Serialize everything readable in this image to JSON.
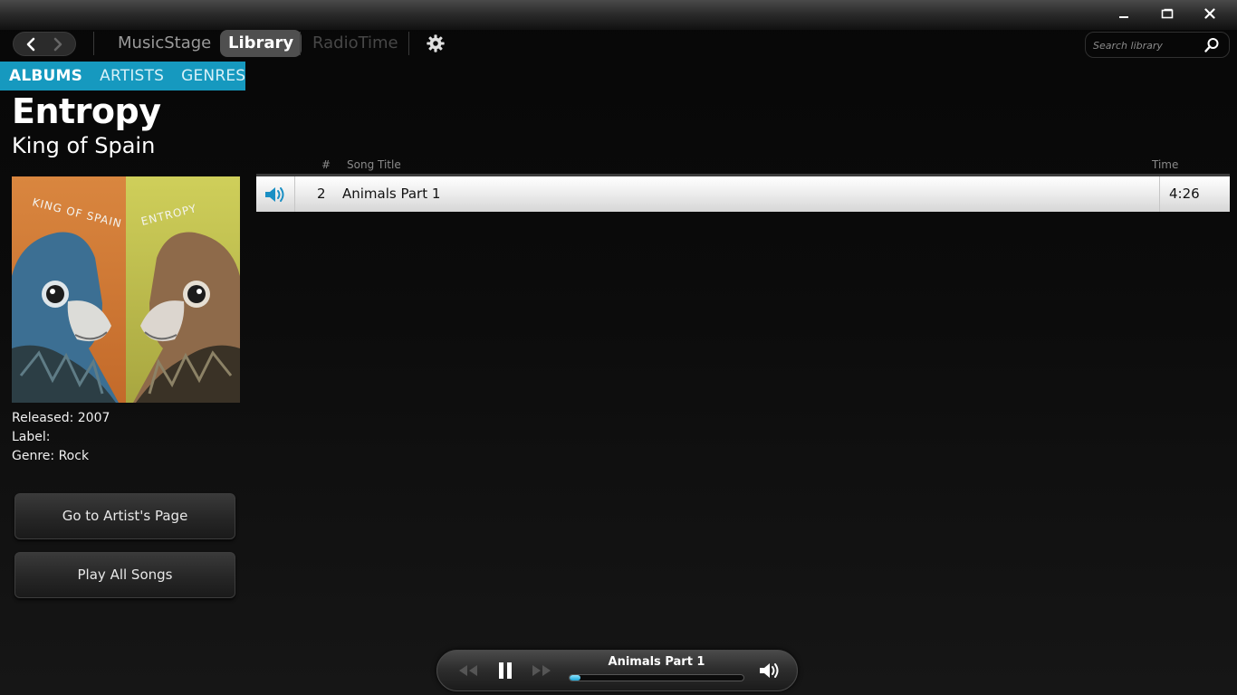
{
  "window": {
    "minimize_label": "",
    "maximize_label": "",
    "close_label": ""
  },
  "nav": {
    "links": [
      "MusicStage",
      "Library",
      "RadioTime"
    ],
    "active": "Library",
    "search_placeholder": "Search library"
  },
  "subtabs": [
    "ALBUMS",
    "ARTISTS",
    "GENRES"
  ],
  "album": {
    "title": "Entropy",
    "artist": "King of Spain",
    "cover_text_left": "KING OF SPAIN",
    "cover_text_right": "ENTROPY",
    "released_label": "Released:",
    "released": "2007",
    "label_label": "Label:",
    "label": "",
    "genre_label": "Genre:",
    "genre": "Rock",
    "goto_artist": "Go to Artist's Page",
    "play_all": "Play All Songs"
  },
  "tracklist": {
    "headers": {
      "number": "#",
      "title": "Song Title",
      "time": "Time"
    },
    "tracks": [
      {
        "number": "2",
        "title": "Animals Part 1",
        "time": "4:26",
        "playing": true
      }
    ]
  },
  "player": {
    "now_playing": "Animals Part 1",
    "progress": 0.06,
    "state": "playing"
  },
  "colors": {
    "accent": "#1699bf",
    "progress_fill": "#1aa6d6",
    "speaker_icon": "#1a8fc4"
  },
  "icons": {
    "back": "chevron-left-icon",
    "forward": "chevron-right-icon",
    "settings": "gear-icon",
    "search": "search-icon",
    "now_playing": "speaker-icon",
    "prev": "rewind-icon",
    "pause": "pause-icon",
    "next": "fast-forward-icon",
    "volume": "volume-icon"
  }
}
